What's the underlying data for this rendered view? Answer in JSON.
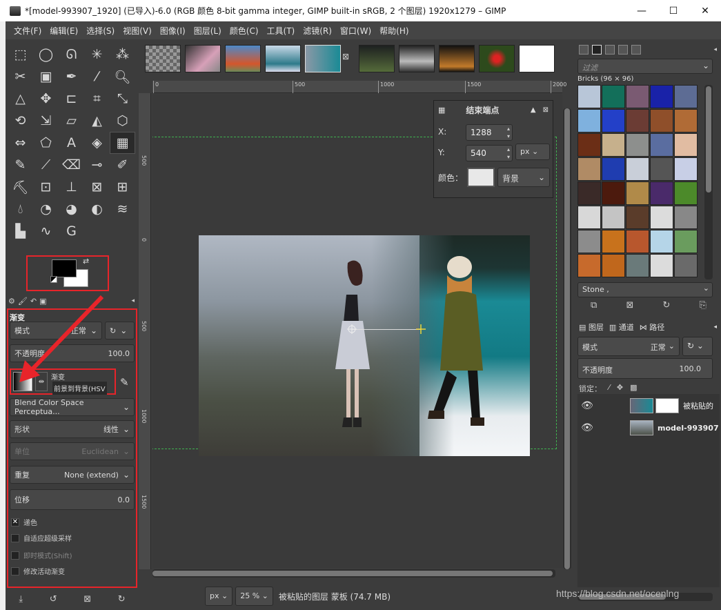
{
  "window": {
    "title": "*[model-993907_1920] (已导入)-6.0 (RGB 颜色 8-bit gamma integer, GIMP built-in sRGB, 2 个图层) 1920x1279 – GIMP",
    "minimize": "—",
    "maximize": "☐",
    "close": "✕"
  },
  "menu": [
    "文件(F)",
    "编辑(E)",
    "选择(S)",
    "视图(V)",
    "图像(I)",
    "图层(L)",
    "颜色(C)",
    "工具(T)",
    "滤镜(R)",
    "窗口(W)",
    "帮助(H)"
  ],
  "toolbox": {
    "tools": [
      "rect-select",
      "ellipse-select",
      "free-select",
      "fuzzy-select",
      "select-by-color",
      "scissors-select",
      "foreground-select",
      "paths",
      "color-picker",
      "zoom",
      "measure",
      "move",
      "align",
      "crop",
      "unified-transform",
      "rotate",
      "scale",
      "shear",
      "flip",
      "perspective",
      "warp",
      "cage",
      "text",
      "bucket-fill",
      "blend",
      "pencil",
      "paintbrush",
      "eraser",
      "airbrush",
      "ink",
      "clone",
      "heal",
      "perspective-clone",
      "smudge",
      "dodge-burn",
      "blur",
      "mypaint-brush",
      "dodge",
      "levels",
      "curves",
      "histogram",
      "curves2",
      "gegl"
    ],
    "active_tool": "blend"
  },
  "tool_options": {
    "title": "渐变",
    "mode_label": "模式",
    "mode_value": "正常",
    "opacity_label": "不透明度",
    "opacity_value": "100.0",
    "gradient_label": "渐变",
    "gradient_name": "前景到背景(HSV",
    "blend_space": "Blend Color Space Perceptua...",
    "shape_label": "形状",
    "shape_value": "线性",
    "metric_label": "单位",
    "metric_value": "Euclidean",
    "repeat_label": "重复",
    "repeat_value": "None (extend)",
    "offset_label": "位移",
    "offset_value": "0.0",
    "dither_label": "递色",
    "dither_checked": true,
    "adaptive_label": "自适应超级采样",
    "instant_label": "即时模式(Shift)",
    "modify_label": "修改活动渐变"
  },
  "end_point": {
    "title": "结束端点",
    "x_label": "X:",
    "x_value": "1288",
    "y_label": "Y:",
    "y_value": "540",
    "unit": "px",
    "color_label": "颜色：",
    "color_value": "背景"
  },
  "rulers": {
    "top": [
      "0",
      "500",
      "1000",
      "1500",
      "2000"
    ],
    "left": [
      "500",
      "0",
      "500",
      "1000",
      "1500"
    ]
  },
  "status": {
    "unit": "px",
    "zoom": "25 %",
    "message": "被粘贴的图层 蒙板 (74.7 MB)"
  },
  "patterns": {
    "filter_placeholder": "过滤",
    "pattern_name": "Bricks (96 × 96)",
    "selected": "Stone ,",
    "colors": [
      "#b8c6d8",
      "#136f5a",
      "#7a5a72",
      "#1922a8",
      "#5d6c94",
      "#7fb1de",
      "#2340c8",
      "#6b3c34",
      "#8f4f2a",
      "#b06b36",
      "#6b2e16",
      "#c6b08c",
      "#8d8f8d",
      "#5a6da0",
      "#e1bca2",
      "#b08b65",
      "#1f3db0",
      "#c9cfd9",
      "#555555",
      "#c8cfe6",
      "#3a2a28",
      "#4c1a0d",
      "#b08a49",
      "#4a2a6a",
      "#4c8a2a",
      "#d8d8d8",
      "#c4c4c4",
      "#5a3c2a",
      "#dcdcdc",
      "#888888",
      "#8c8c8c",
      "#c8721c",
      "#b8572d",
      "#b5d5e8",
      "#6a9c5e",
      "#c76a2c",
      "#c0671c",
      "#6a7a7a",
      "#dcdcdc",
      "#6a6a6a"
    ]
  },
  "layers": {
    "tabs": [
      "图层",
      "通道",
      "路径"
    ],
    "mode_label": "模式",
    "mode_value": "正常",
    "opacity_label": "不透明度",
    "opacity_value": "100.0",
    "lock_label": "锁定：",
    "items": [
      {
        "name": "被粘贴的",
        "has_mask": true
      },
      {
        "name": "model-993907",
        "has_mask": false
      }
    ]
  },
  "watermark": "https://blog.csdn.net/ocenlng"
}
